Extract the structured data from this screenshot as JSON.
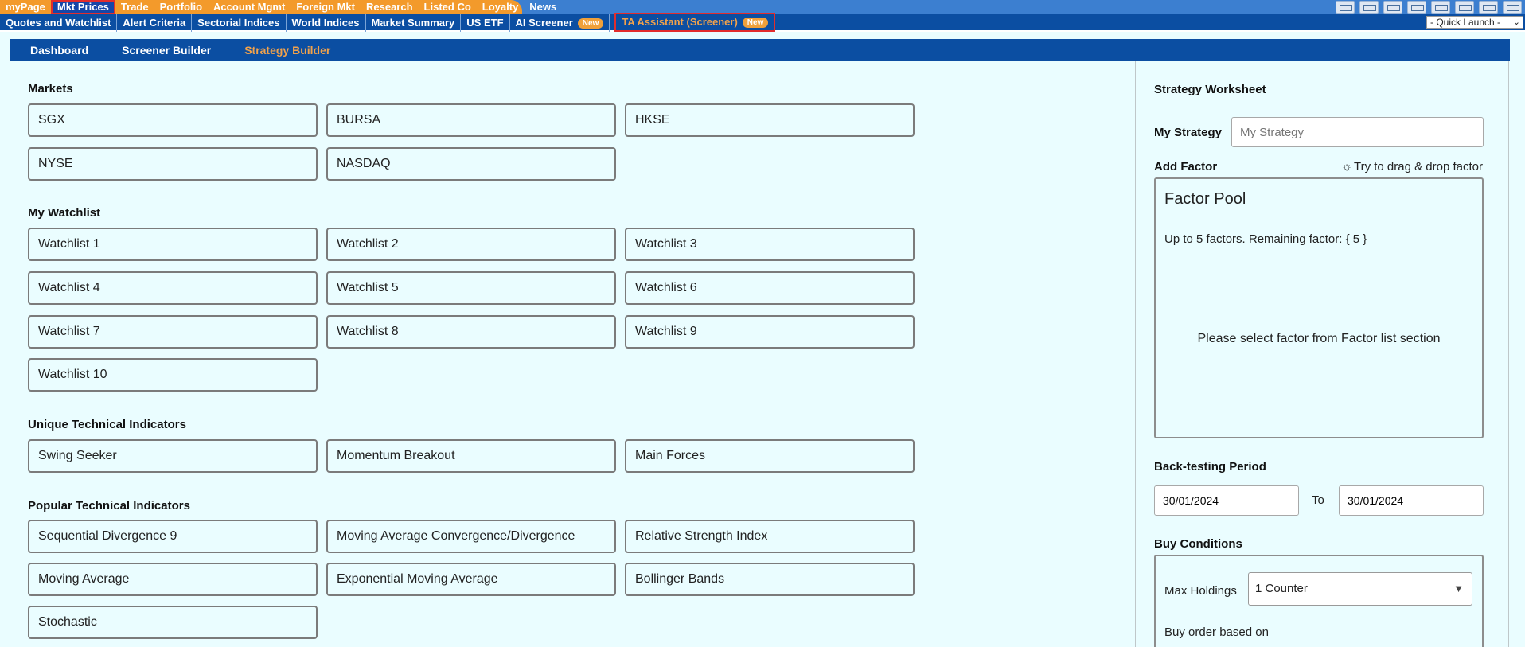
{
  "top_nav": [
    "myPage",
    "Mkt Prices",
    "Trade",
    "Portfolio",
    "Account Mgmt",
    "Foreign Mkt",
    "Research",
    "Listed Co",
    "Loyalty",
    "News"
  ],
  "top_tools": [
    "tool-1-icon",
    "tool-2-icon",
    "tool-3-icon",
    "tool-4-icon",
    "tool-5-icon",
    "tool-6-icon",
    "tool-7-icon",
    "tool-8-icon"
  ],
  "sub_nav": {
    "items": [
      "Quotes and Watchlist",
      "Alert Criteria",
      "Sectorial Indices",
      "World Indices",
      "Market Summary",
      "US ETF"
    ],
    "ai_screener": "AI Screener",
    "ai_badge": "New",
    "ta": "TA Assistant (Screener)",
    "ta_badge": "New",
    "quick_launch": "- Quick Launch -"
  },
  "tabs": [
    "Dashboard",
    "Screener Builder",
    "Strategy Builder"
  ],
  "sections": {
    "markets": {
      "title": "Markets",
      "items": [
        "SGX",
        "BURSA",
        "HKSE",
        "NYSE",
        "NASDAQ"
      ]
    },
    "watchlist": {
      "title": "My Watchlist",
      "items": [
        "Watchlist 1",
        "Watchlist 2",
        "Watchlist 3",
        "Watchlist 4",
        "Watchlist 5",
        "Watchlist 6",
        "Watchlist 7",
        "Watchlist 8",
        "Watchlist 9",
        "Watchlist 10"
      ]
    },
    "unique": {
      "title": "Unique Technical Indicators",
      "items": [
        "Swing Seeker",
        "Momentum Breakout",
        "Main Forces"
      ]
    },
    "popular": {
      "title": "Popular Technical Indicators",
      "items": [
        "Sequential Divergence 9",
        "Moving Average Convergence/Divergence",
        "Relative Strength Index",
        "Moving Average",
        "Exponential Moving Average",
        "Bollinger Bands",
        "Stochastic"
      ]
    }
  },
  "worksheet": {
    "title": "Strategy Worksheet",
    "my_strategy_label": "My Strategy",
    "my_strategy_placeholder": "My Strategy",
    "add_factor": "Add Factor",
    "drag_hint": "Try to drag & drop factor",
    "pool_title": "Factor Pool",
    "pool_hint": "Up to 5 factors. Remaining factor: { 5 }",
    "pool_empty": "Please select factor from Factor list section",
    "backtest_title": "Back-testing Period",
    "from_date": "30/01/2024",
    "to_label": "To",
    "to_date": "30/01/2024",
    "buy_title": "Buy Conditions",
    "max_holdings_label": "Max Holdings",
    "max_holdings_value": "1 Counter",
    "buy_order_label": "Buy order based on"
  }
}
